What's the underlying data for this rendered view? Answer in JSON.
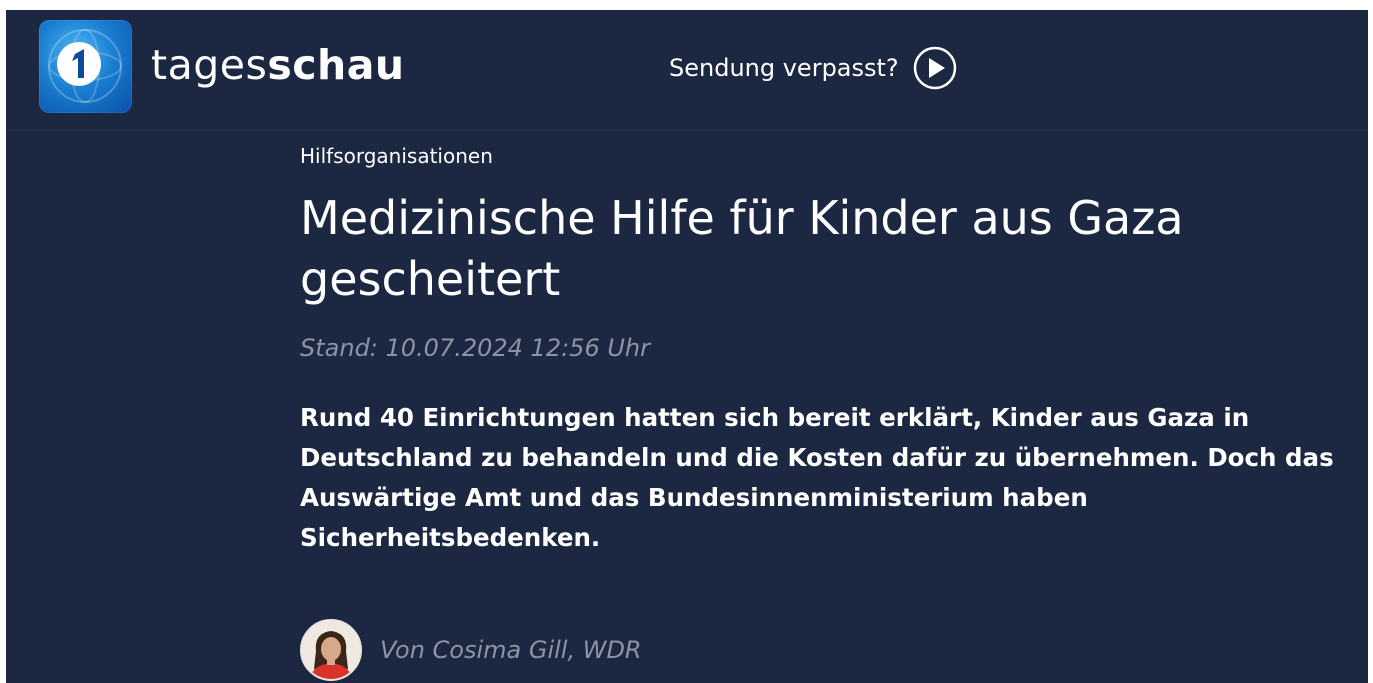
{
  "header": {
    "brand_light": "tages",
    "brand_bold": "schau",
    "logo_icon": "ard-one-globe-icon",
    "missed_label": "Sendung verpasst?",
    "missed_icon": "play-circle-icon"
  },
  "article": {
    "kicker": "Hilfsorganisationen",
    "headline": "Medizinische Hilfe für Kinder aus Gaza gescheitert",
    "stand": "Stand: 10.07.2024 12:56 Uhr",
    "teaser": "Rund 40 Einrichtungen hatten sich bereit erklärt, Kinder aus Gaza in Deutschland zu behandeln und die Kosten dafür zu übernehmen. Doch das Auswärtige Amt und das Bundesinnenministerium haben Sicherheitsbedenken.",
    "author": "Von Cosima Gill, WDR",
    "author_icon": "author-avatar"
  },
  "colors": {
    "background": "#1c2741",
    "text": "#ffffff",
    "muted": "#8c93a4",
    "logo_blue": "#1a7fd2"
  }
}
